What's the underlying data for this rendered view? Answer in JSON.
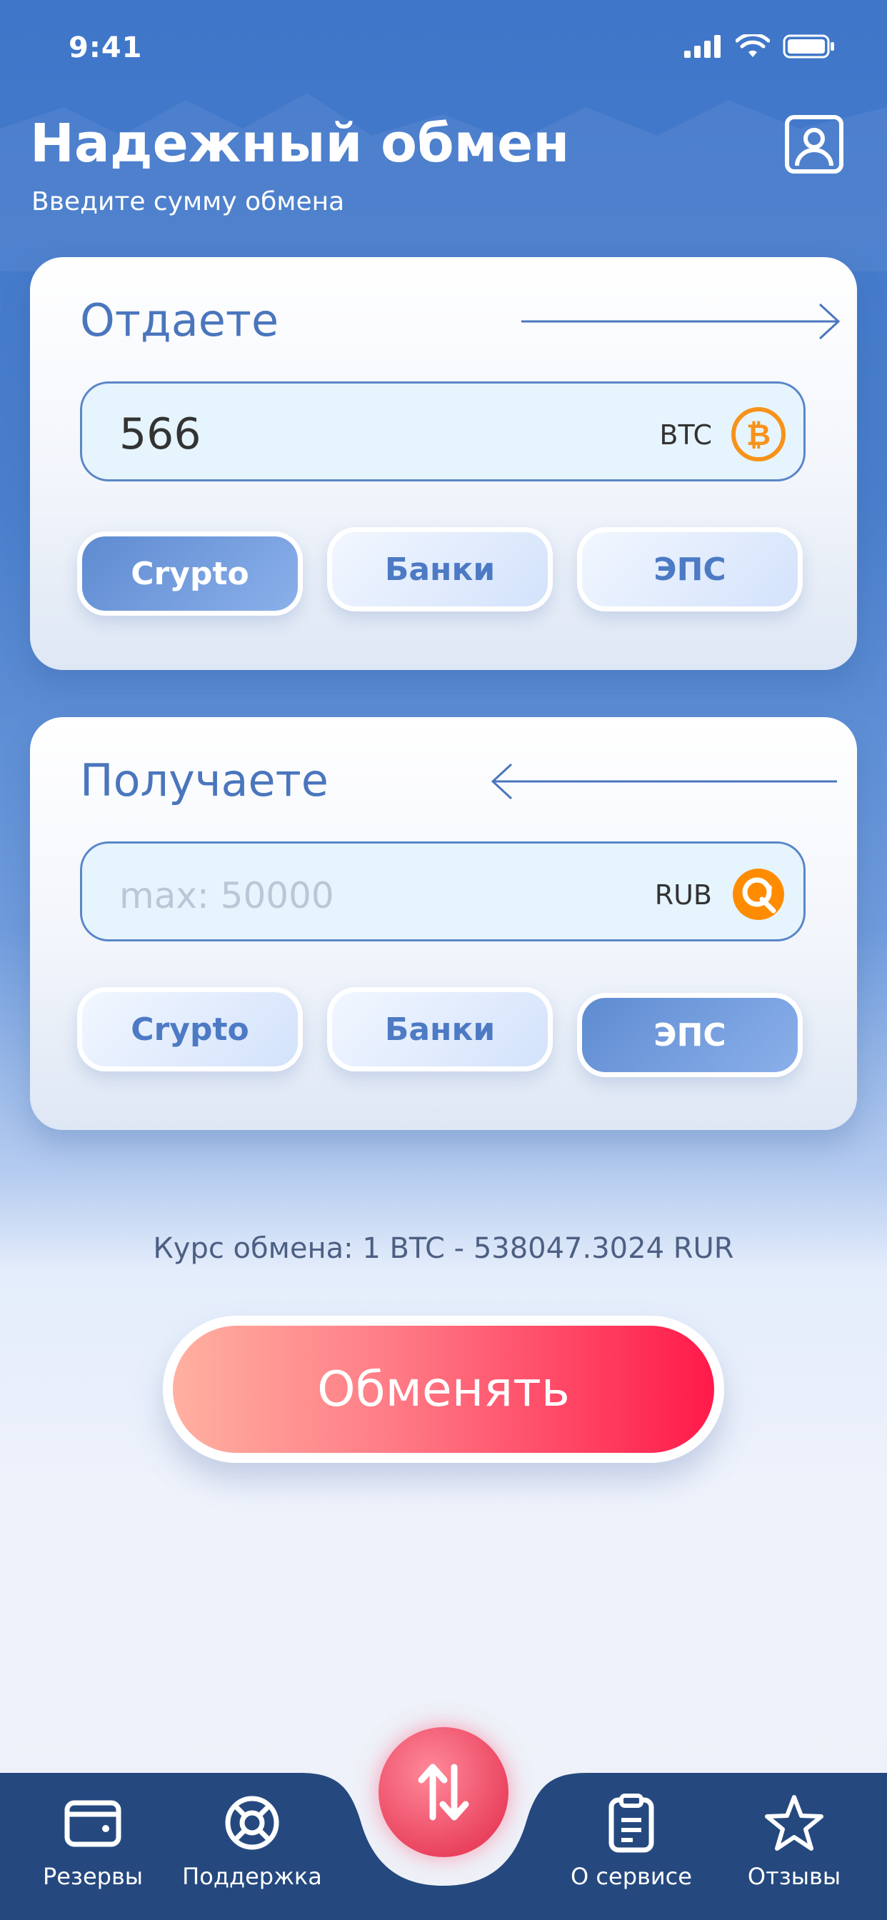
{
  "status_bar": {
    "time": "9:41"
  },
  "header": {
    "title": "Надежный обмен",
    "subtitle": "Введите сумму обмена"
  },
  "give": {
    "label": "Отдаете",
    "amount": "566",
    "currency": "BTC",
    "tabs": [
      "Crypto",
      "Банки",
      "ЭПС"
    ],
    "active_tab": "Crypto"
  },
  "receive": {
    "label": "Получаете",
    "placeholder": "max: 50000",
    "currency": "RUB",
    "tabs": [
      "Crypto",
      "Банки",
      "ЭПС"
    ],
    "active_tab": "ЭПС"
  },
  "rate_text": "Курс обмена: 1 BTC - 538047.3024 RUR",
  "exchange_button": "Обменять",
  "nav": {
    "reserves": "Резервы",
    "support": "Поддержка",
    "about": "О сервисе",
    "reviews": "Отзывы"
  },
  "colors": {
    "accent_blue": "#4a76bd",
    "nav_bg": "#25497f",
    "exchange_red": "#ff1a4a",
    "bitcoin_orange": "#f7931a",
    "qiwi_orange": "#ff8c00"
  },
  "icons": {
    "profile": "profile-card-icon",
    "give_coin": "bitcoin-icon",
    "receive_coin": "qiwi-icon",
    "fab": "swap-arrows-icon",
    "reserves": "wallet-icon",
    "support": "lifebuoy-icon",
    "about": "clipboard-icon",
    "reviews": "star-icon"
  }
}
